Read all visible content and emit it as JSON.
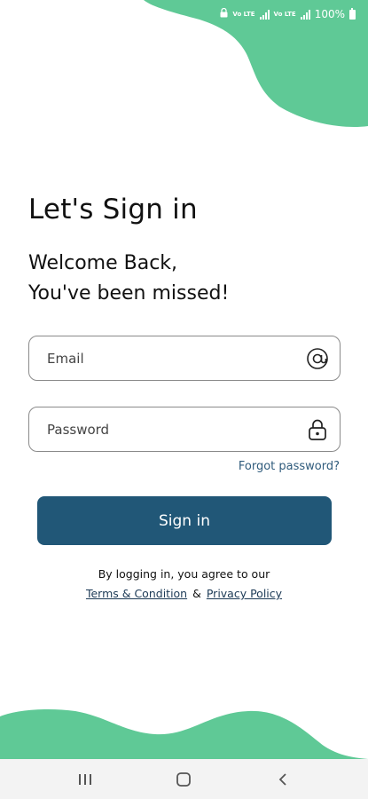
{
  "colors": {
    "accent_green": "#5fc996",
    "primary_button": "#215777",
    "link": "#1c3a56"
  },
  "status_bar": {
    "battery_text": "100%",
    "network_labels": [
      "Vo LTE",
      "Vo LTE"
    ],
    "icons": [
      "lock-icon",
      "signal-icon",
      "signal-icon",
      "battery-icon"
    ]
  },
  "header": {
    "title": "Let's Sign in",
    "subtitle_line1": "Welcome Back,",
    "subtitle_line2": "You've been missed!"
  },
  "form": {
    "email": {
      "placeholder": "Email",
      "value": "",
      "icon": "at-sign-icon"
    },
    "password": {
      "placeholder": "Password",
      "value": "",
      "icon": "lock-icon"
    },
    "forgot_label": "Forgot password?",
    "signin_label": "Sign in"
  },
  "terms": {
    "prefix": "By logging in, you agree to our",
    "terms_link": "Terms & Condition",
    "amp": "&",
    "privacy_link": "Privacy Policy"
  },
  "nav_bar": {
    "icons": [
      "recent-apps-icon",
      "home-icon",
      "back-icon"
    ]
  }
}
